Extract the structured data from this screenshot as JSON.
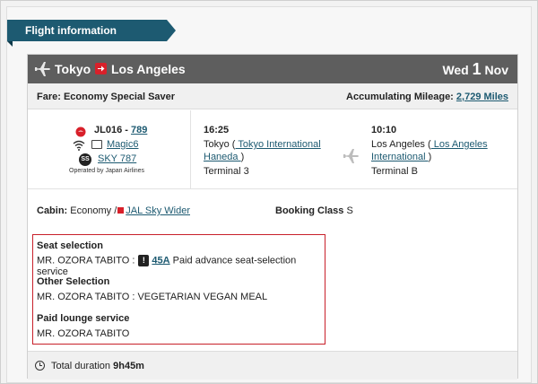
{
  "header": {
    "tab_label": "Flight information"
  },
  "route": {
    "origin": "Tokyo",
    "destination": "Los Angeles",
    "weekday": "Wed",
    "day": "1",
    "month": "Nov"
  },
  "fare": {
    "label": "Fare: Economy Special Saver",
    "mileage_label": "Accumulating Mileage:",
    "mileage_value": "2,729 Miles"
  },
  "segment": {
    "flight_number": "JL016 -",
    "flight_link": "789",
    "entertainment": "Magic6",
    "aircraft": "SKY 787",
    "operated_by": "Operated by Japan Airlines",
    "ss_badge": "SS",
    "departure": {
      "time": "16:25",
      "city": "Tokyo",
      "airport_link": " Tokyo International Haneda ",
      "terminal": "Terminal 3"
    },
    "arrival": {
      "time": "10:10",
      "city": "Los Angeles",
      "airport_link": " Los Angeles International ",
      "terminal": "Terminal B"
    }
  },
  "cabin": {
    "label": "Cabin:",
    "value": "Economy /",
    "seat_link": "JAL Sky Wider",
    "booking_label": "Booking Class",
    "booking_value": "S"
  },
  "services": {
    "seat_heading": "Seat selection",
    "seat_passenger": "MR. OZORA TABITO :",
    "seat_icon": "!",
    "seat_number": "45A",
    "seat_desc": "Paid advance seat-selection service",
    "other_heading": "Other Selection",
    "other_text": "MR. OZORA TABITO :  VEGETARIAN VEGAN MEAL",
    "lounge_heading": "Paid lounge service",
    "lounge_text": "MR. OZORA TABITO"
  },
  "duration": {
    "label": "Total duration",
    "value": "9h45m"
  },
  "colors": {
    "tab": "#1d5a71",
    "route_bar": "#5e5e5e",
    "accent_red": "#d8202a",
    "link": "#1d5a71"
  },
  "icons": [
    "plane-icon",
    "arrow-right-icon",
    "jal-crane-icon",
    "wifi-icon",
    "tv-icon",
    "ss-icon",
    "plane-mid-icon",
    "flag-icon",
    "exclamation-icon",
    "clock-icon"
  ]
}
